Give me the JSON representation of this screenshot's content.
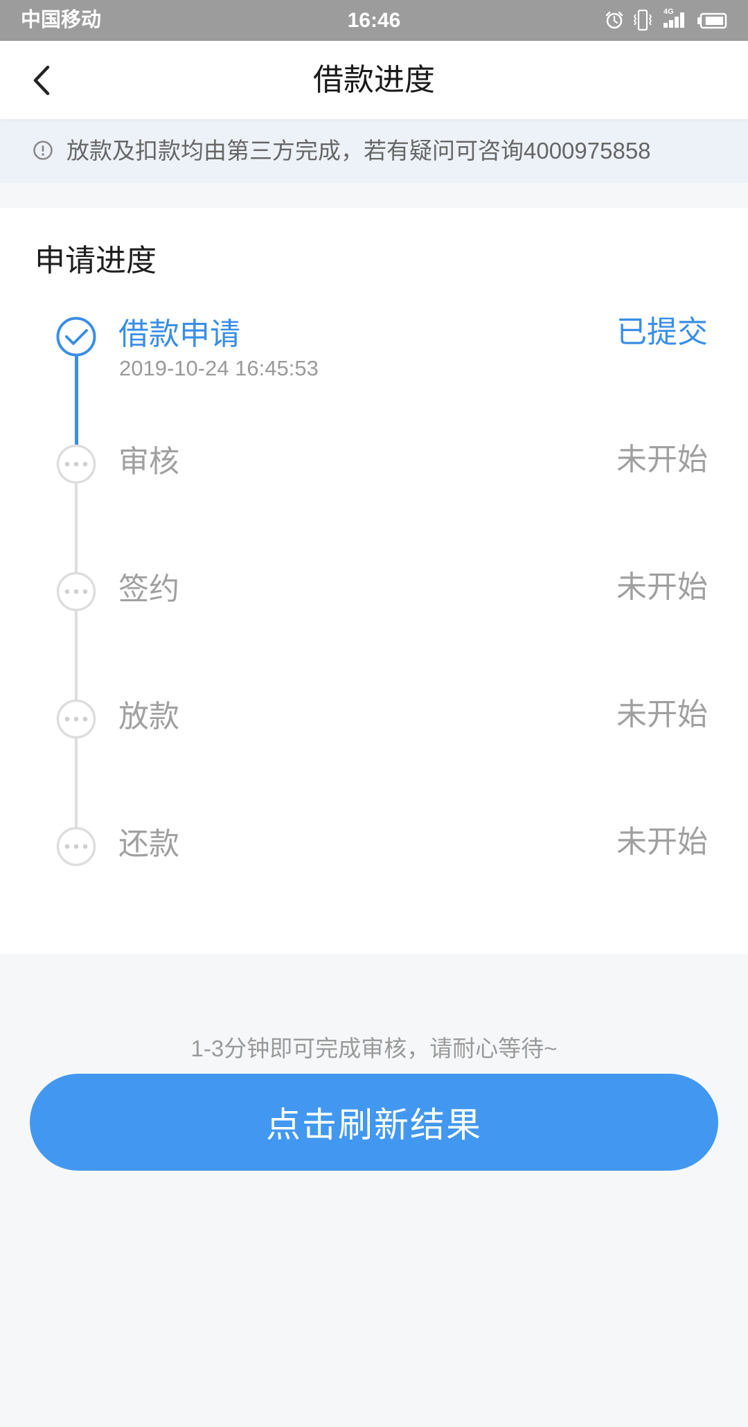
{
  "status_bar": {
    "carrier": "中国移动",
    "time": "16:46",
    "network_type": "4G",
    "signal_bars": 4,
    "battery_level": 0.9,
    "icons": [
      "alarm-icon",
      "vibrate-icon",
      "signal-icon",
      "battery-icon"
    ]
  },
  "header": {
    "title": "借款进度",
    "back_icon": "chevron-left-icon"
  },
  "notice": {
    "icon": "info-icon",
    "text": "放款及扣款均由第三方完成，若有疑问可咨询4000975858"
  },
  "progress": {
    "title": "申请进度",
    "steps": [
      {
        "label": "借款申请",
        "status": "已提交",
        "time": "2019-10-24 16:45:53",
        "icon": "check-circle-icon"
      },
      {
        "label": "审核",
        "status": "未开始",
        "icon": "pending-dots-icon"
      },
      {
        "label": "签约",
        "status": "未开始",
        "icon": "pending-dots-icon"
      },
      {
        "label": "放款",
        "status": "未开始",
        "icon": "pending-dots-icon"
      },
      {
        "label": "还款",
        "status": "未开始",
        "icon": "pending-dots-icon"
      }
    ]
  },
  "footer": {
    "hint": "1-3分钟即可完成审核，请耐心等待~",
    "refresh_button": "点击刷新结果"
  },
  "colors": {
    "accent": "#3a8ee6",
    "button": "#4298f0",
    "status_bar": "#9c9c9c",
    "notice_bg": "#edf2f8",
    "pending_text": "#a0a0a0",
    "pending_line": "#dddddd"
  }
}
